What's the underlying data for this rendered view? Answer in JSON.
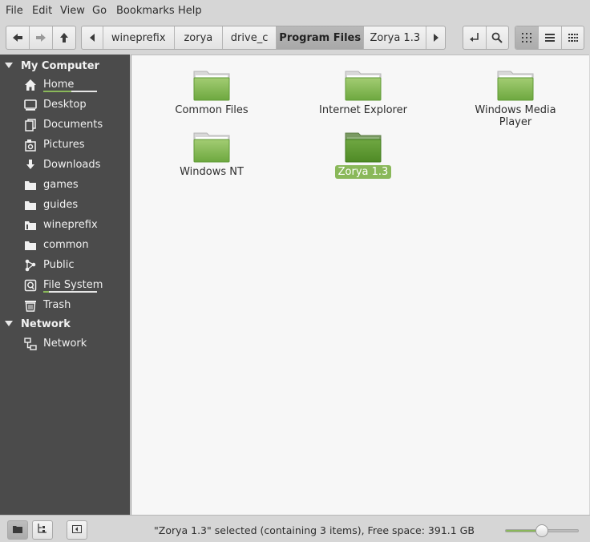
{
  "menubar": {
    "items": [
      "File",
      "Edit",
      "View",
      "Go",
      "Bookmarks",
      "Help"
    ]
  },
  "toolbar": {
    "nav_icons": [
      "back-arrow-icon",
      "forward-arrow-icon",
      "up-arrow-icon"
    ],
    "breadcrumbs": [
      "wineprefix",
      "zorya",
      "drive_c",
      "Program Files",
      "Zorya 1.3"
    ],
    "active_crumb": "Program Files",
    "view_icons": [
      "icon-view-icon",
      "list-view-icon",
      "compact-view-icon"
    ]
  },
  "sidebar": {
    "sections": [
      {
        "title": "My Computer",
        "items": [
          {
            "label": "Home",
            "icon": "home-icon",
            "usage": 0.52
          },
          {
            "label": "Desktop",
            "icon": "desktop-icon"
          },
          {
            "label": "Documents",
            "icon": "documents-icon"
          },
          {
            "label": "Pictures",
            "icon": "pictures-icon"
          },
          {
            "label": "Downloads",
            "icon": "downloads-icon"
          },
          {
            "label": "games",
            "icon": "folder-icon"
          },
          {
            "label": "guides",
            "icon": "folder-icon"
          },
          {
            "label": "wineprefix",
            "icon": "folder-icon"
          },
          {
            "label": "common",
            "icon": "folder-icon"
          },
          {
            "label": "Public",
            "icon": "public-share-icon"
          },
          {
            "label": "File System",
            "icon": "filesystem-drive-icon",
            "usage": 0.1
          },
          {
            "label": "Trash",
            "icon": "trash-icon"
          }
        ]
      },
      {
        "title": "Network",
        "items": [
          {
            "label": "Network",
            "icon": "network-icon"
          }
        ]
      }
    ]
  },
  "files": [
    {
      "name": "Common Files",
      "selected": false
    },
    {
      "name": "Internet Explorer",
      "selected": false
    },
    {
      "name": "Windows Media Player",
      "selected": false
    },
    {
      "name": "Windows NT",
      "selected": false
    },
    {
      "name": "Zorya 1.3",
      "selected": true
    }
  ],
  "statusbar": {
    "text": "\"Zorya 1.3\" selected (containing 3 items), Free space: 391.1 GB",
    "zoom_level": 0.5
  },
  "colors": {
    "accent": "#8ab85a",
    "sidebar_bg": "#4b4b4b",
    "folder_green": "#7fb34e"
  }
}
